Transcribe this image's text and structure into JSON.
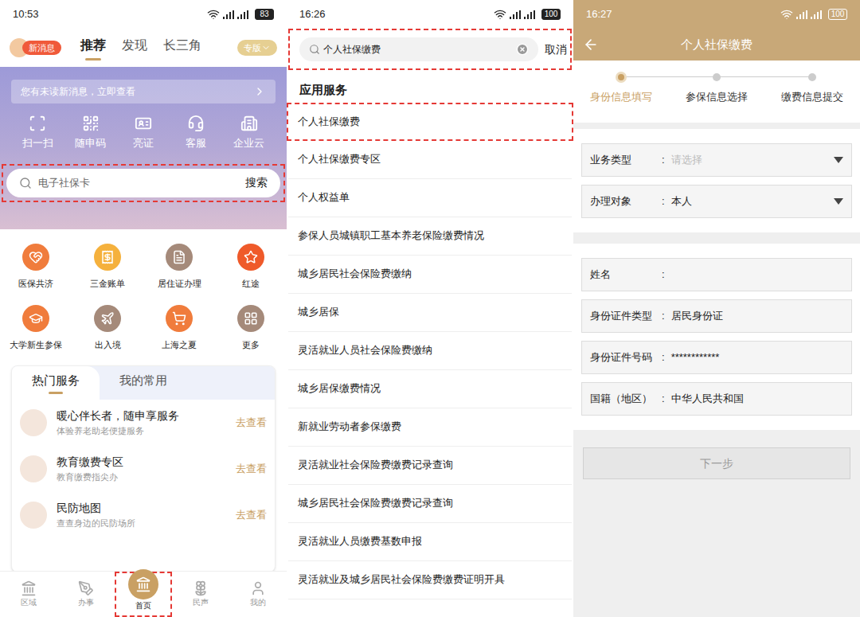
{
  "panels": [
    {
      "status_bar": {
        "time": "10:53",
        "battery": "83"
      },
      "nav": {
        "badge": "新消息",
        "tabs": [
          {
            "label": "推荐",
            "selected": true
          },
          {
            "label": "发现",
            "selected": false
          },
          {
            "label": "长三角",
            "selected": false
          }
        ],
        "edition": "专版"
      },
      "notice": "您有未读新消息，立即查看",
      "quick_actions": [
        "扫一扫",
        "随申码",
        "亮证",
        "客服",
        "企业云"
      ],
      "search": {
        "placeholder": "电子社保卡",
        "button": "搜索",
        "highlighted": true
      },
      "services": [
        {
          "label": "医保共济",
          "color": "#f07c3c"
        },
        {
          "label": "三金账单",
          "color": "#f5b13d"
        },
        {
          "label": "居住证办理",
          "color": "#a58a7a"
        },
        {
          "label": "红途",
          "color": "#ef5a2a"
        },
        {
          "label": "大学新生参保",
          "color": "#f07c3c"
        },
        {
          "label": "出入境",
          "color": "#a58a7a"
        },
        {
          "label": "上海之夏",
          "color": "#f07c3c"
        },
        {
          "label": "更多",
          "color": "#a58a7a"
        }
      ],
      "card_tabs": [
        {
          "label": "热门服务",
          "selected": true
        },
        {
          "label": "我的常用",
          "selected": false
        }
      ],
      "card_items": [
        {
          "title": "暖心伴长者，随申享服务",
          "subtitle": "体验养老助老便捷服务",
          "action": "去查看"
        },
        {
          "title": "教育缴费专区",
          "subtitle": "教育缴费指尖办",
          "action": "去查看"
        },
        {
          "title": "民防地图",
          "subtitle": "查查身边的民防场所",
          "action": "去查看"
        }
      ],
      "bottom_nav": [
        {
          "label": "区域",
          "selected": false,
          "highlighted": false
        },
        {
          "label": "办事",
          "selected": false,
          "highlighted": false
        },
        {
          "label": "首页",
          "selected": true,
          "highlighted": true
        },
        {
          "label": "民声",
          "selected": false,
          "highlighted": false
        },
        {
          "label": "我的",
          "selected": false,
          "highlighted": false
        }
      ]
    },
    {
      "status_bar": {
        "time": "16:26",
        "battery": "100"
      },
      "search": {
        "value": "个人社保缴费",
        "cancel": "取消",
        "highlighted": true
      },
      "section": "应用服务",
      "results": [
        {
          "label": "个人社保缴费",
          "highlighted": true
        },
        {
          "label": "个人社保缴费专区",
          "highlighted": false
        },
        {
          "label": "个人权益单",
          "highlighted": false
        },
        {
          "label": "参保人员城镇职工基本养老保险缴费情况",
          "highlighted": false
        },
        {
          "label": "城乡居民社会保险费缴纳",
          "highlighted": false
        },
        {
          "label": "城乡居保",
          "highlighted": false
        },
        {
          "label": "灵活就业人员社会保险费缴纳",
          "highlighted": false
        },
        {
          "label": "城乡居保缴费情况",
          "highlighted": false
        },
        {
          "label": "新就业劳动者参保缴费",
          "highlighted": false
        },
        {
          "label": "灵活就业社会保险费缴费记录查询",
          "highlighted": false
        },
        {
          "label": "城乡居民社会保险费缴费记录查询",
          "highlighted": false
        },
        {
          "label": "灵活就业人员缴费基数申报",
          "highlighted": false
        },
        {
          "label": "灵活就业及城乡居民社会保险费缴费证明开具",
          "highlighted": false
        }
      ]
    },
    {
      "status_bar": {
        "time": "16:27",
        "battery": "100"
      },
      "title": "个人社保缴费",
      "steps": [
        {
          "label": "身份信息填写",
          "selected": true
        },
        {
          "label": "参保信息选择",
          "selected": false
        },
        {
          "label": "缴费信息提交",
          "selected": false
        }
      ],
      "groups": [
        [
          {
            "label": "业务类型",
            "separator": ":",
            "value": "请选择",
            "placeholder": true,
            "kind": "dropdown"
          },
          {
            "label": "办理对象",
            "separator": ":",
            "value": "本人",
            "placeholder": false,
            "kind": "dropdown"
          }
        ],
        [
          {
            "label": "姓名",
            "separator": ":",
            "value": "",
            "placeholder": false,
            "kind": "text"
          },
          {
            "label": "身份证件类型",
            "separator": ":",
            "value": "居民身份证",
            "placeholder": false,
            "kind": "text"
          },
          {
            "label": "身份证件号码",
            "separator": ":",
            "value": "************",
            "placeholder": false,
            "kind": "text"
          },
          {
            "label": "国籍（地区）",
            "separator": ":",
            "value": "中华人民共和国",
            "placeholder": false,
            "kind": "text"
          }
        ]
      ],
      "button": {
        "label": "下一步",
        "disabled": true
      }
    }
  ]
}
